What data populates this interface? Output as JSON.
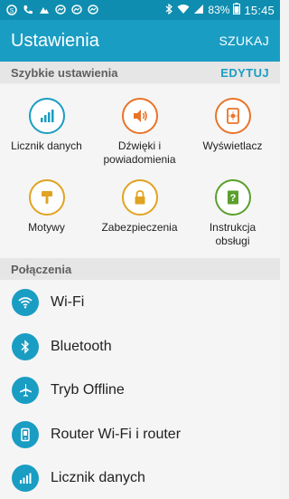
{
  "status_bar": {
    "battery": "83%",
    "time": "15:45",
    "icons": [
      "skype-icon",
      "phone-icon",
      "image-icon",
      "messenger-icon",
      "messenger-icon",
      "messenger-icon",
      "bluetooth-icon",
      "wifi-icon",
      "signal-icon",
      "battery-icon"
    ]
  },
  "app_bar": {
    "title": "Ustawienia",
    "search_label": "SZUKAJ"
  },
  "quick_settings": {
    "header": "Szybkie ustawienia",
    "edit_label": "EDYTUJ",
    "items": [
      {
        "label": "Licznik danych",
        "icon": "data-usage-icon",
        "color": "#1a9dc3"
      },
      {
        "label": "Dźwięki i powiadomienia",
        "icon": "volume-icon",
        "color": "#e8742a"
      },
      {
        "label": "Wyświetlacz",
        "icon": "display-icon",
        "color": "#e8742a"
      },
      {
        "label": "Motywy",
        "icon": "brush-icon",
        "color": "#e0a323"
      },
      {
        "label": "Zabezpieczenia",
        "icon": "lock-icon",
        "color": "#e0a323"
      },
      {
        "label": "Instrukcja obsługi",
        "icon": "help-book-icon",
        "color": "#5aa02c"
      }
    ]
  },
  "connections": {
    "header": "Połączenia",
    "items": [
      {
        "label": "Wi-Fi",
        "icon": "wifi-icon"
      },
      {
        "label": "Bluetooth",
        "icon": "bluetooth-icon"
      },
      {
        "label": "Tryb Offline",
        "icon": "airplane-icon"
      },
      {
        "label": "Router Wi-Fi i router",
        "icon": "hotspot-icon"
      },
      {
        "label": "Licznik danych",
        "icon": "data-usage-icon"
      }
    ]
  },
  "colors": {
    "accent": "#1a9dc3",
    "status_bar": "#0f8db0"
  }
}
